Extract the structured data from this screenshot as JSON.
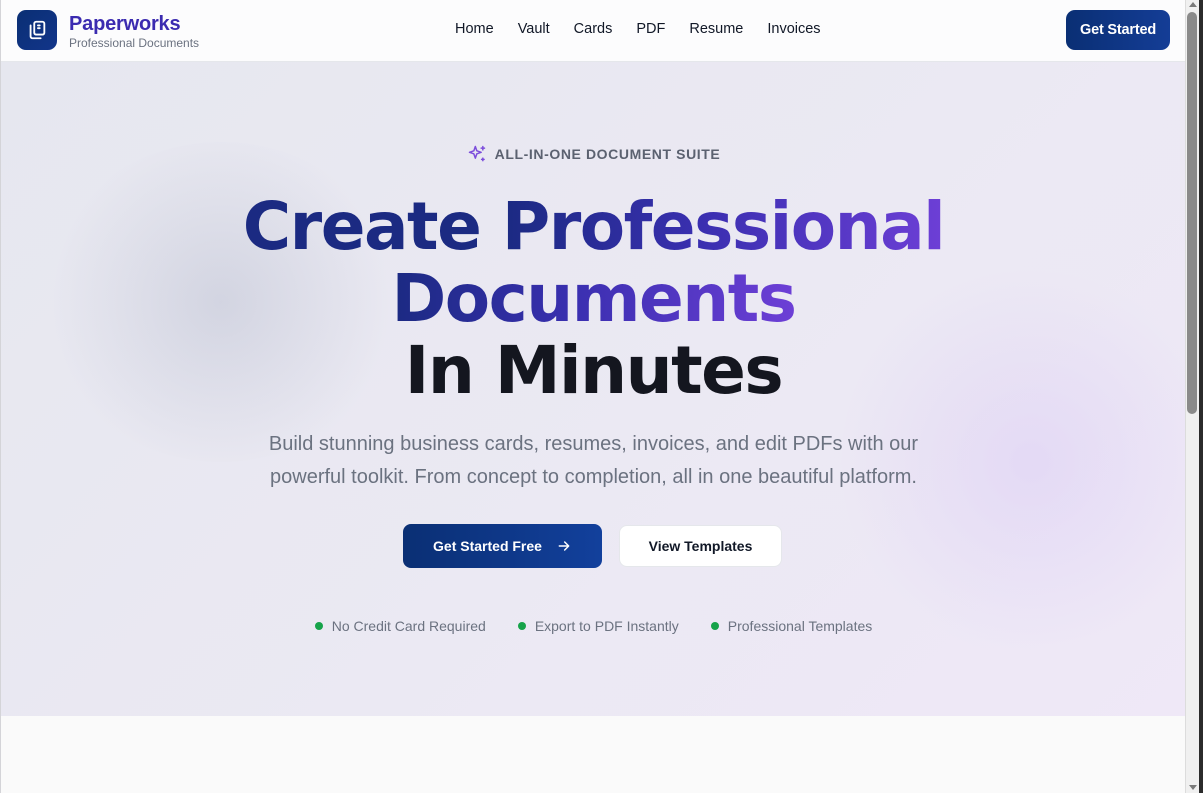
{
  "brand": {
    "name": "Paperworks",
    "tagline": "Professional Documents",
    "logo_icon": "documents-icon",
    "accent": "#3b2bb0",
    "primary": "#0a2f74"
  },
  "nav": {
    "links": [
      "Home",
      "Vault",
      "Cards",
      "PDF",
      "Resume",
      "Invoices"
    ],
    "cta": "Get Started"
  },
  "hero": {
    "eyebrow_icon": "sparkles-icon",
    "eyebrow": "ALL-IN-ONE DOCUMENT SUITE",
    "title_part1": "Create ",
    "title_part2": "Professional",
    "title_line2": "Documents",
    "title_line3": "In Minutes",
    "subtitle_line1": "Build stunning business cards, resumes, invoices, and edit PDFs with our",
    "subtitle_line2": "powerful toolkit. From concept to completion, all in one beautiful platform.",
    "primary_button": "Get Started Free",
    "primary_button_icon": "arrow-right-icon",
    "secondary_button": "View Templates",
    "features": [
      "No Credit Card Required",
      "Export to PDF Instantly",
      "Professional Templates"
    ],
    "feature_dot_color": "#16a34a"
  }
}
